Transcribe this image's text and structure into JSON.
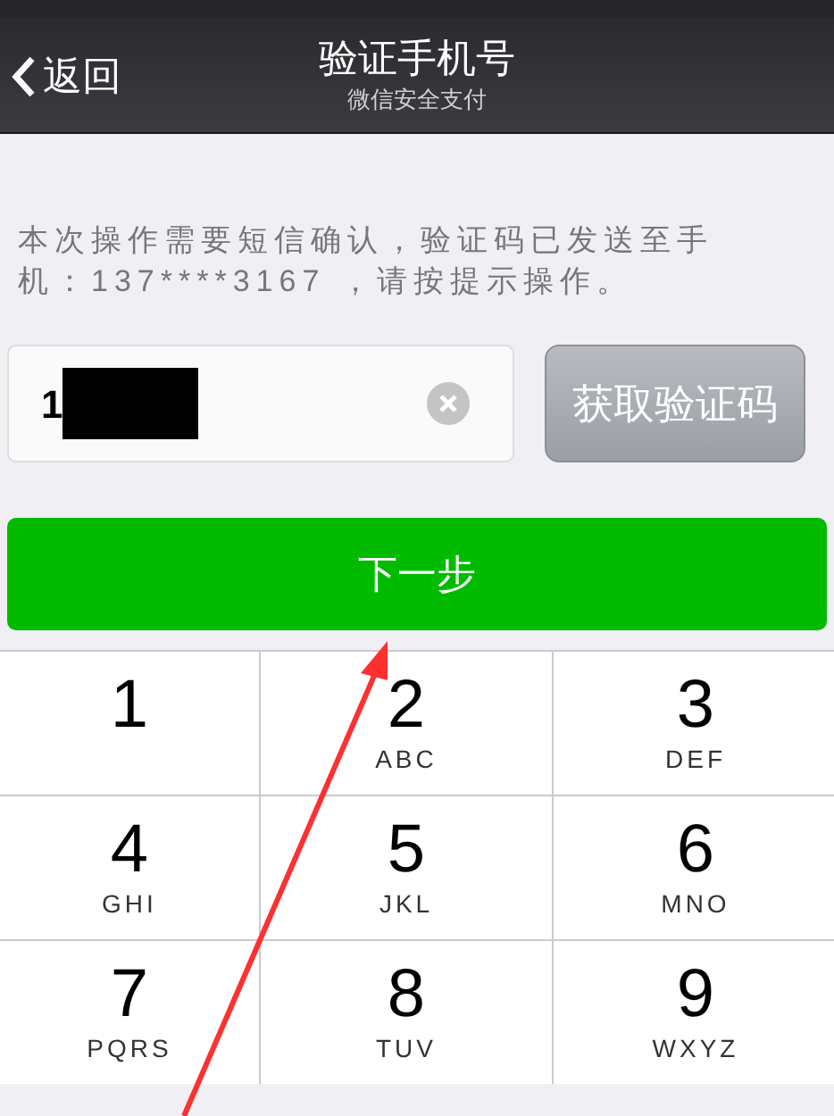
{
  "nav": {
    "back": "返回",
    "title": "验证手机号",
    "subtitle": "微信安全支付"
  },
  "message": "本次操作需要短信确认，验证码已发送至手机：137****3167 ，请按提示操作。",
  "phone_field": {
    "value": "1",
    "redacted": true
  },
  "code_button": {
    "label": "获取验证码",
    "disabled": true
  },
  "next_button": {
    "label": "下一步"
  },
  "keypad": [
    {
      "digit": "1"
    },
    {
      "digit": "2",
      "letters": "ABC"
    },
    {
      "digit": "3",
      "letters": "DEF"
    },
    {
      "digit": "4",
      "letters": "GHI"
    },
    {
      "digit": "5",
      "letters": "JKL"
    },
    {
      "digit": "6",
      "letters": "MNO"
    },
    {
      "digit": "7",
      "letters": "PQRS"
    },
    {
      "digit": "8",
      "letters": "TUV"
    },
    {
      "digit": "9",
      "letters": "WXYZ"
    }
  ]
}
